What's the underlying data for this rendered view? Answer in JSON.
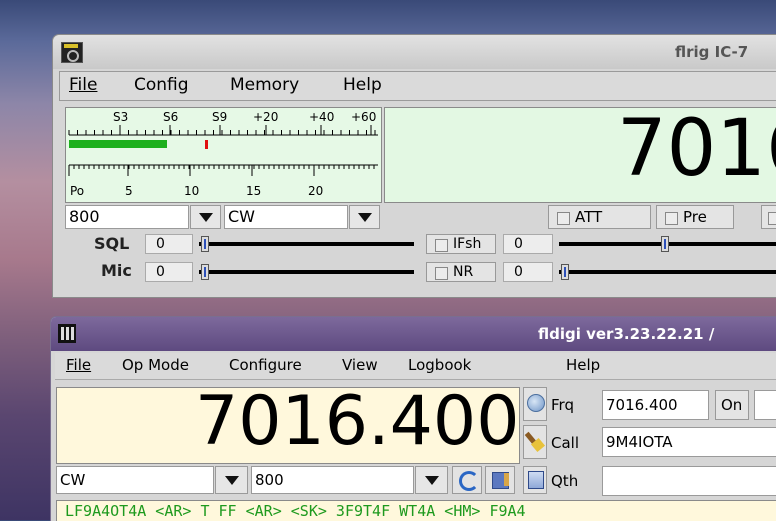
{
  "flrig": {
    "title": "flrig IC-7",
    "menu": [
      "File",
      "Config",
      "Memory",
      "Help"
    ],
    "meter_top_labels": [
      "S3",
      "S6",
      "S9",
      "+20",
      "+40",
      "+60"
    ],
    "meter_bottom_labels": [
      "Po",
      "5",
      "10",
      "15",
      "20"
    ],
    "frequency": "7016",
    "bandwidth": "800",
    "mode": "CW",
    "att_label": "ATT",
    "pre_label": "Pre",
    "sql_label": "SQL",
    "sql_value": "0",
    "mic_label": "Mic",
    "mic_value": "0",
    "ifsh_label": "IFsh",
    "ifsh_value": "0",
    "nr_label": "NR",
    "nr_value": "0",
    "signal_level": 0.31
  },
  "fldigi": {
    "title": "fldigi ver3.23.22.21 /",
    "menu": [
      "File",
      "Op Mode",
      "Configure",
      "View",
      "Logbook",
      "Help"
    ],
    "frequency": "7016.400",
    "frq_label": "Frq",
    "frq_value": "7016.400",
    "on_label": "On",
    "call_label": "Call",
    "call_value": "9M4IOTA",
    "qth_label": "Qth",
    "mode": "CW",
    "bandwidth": "800",
    "rx_text": "LF9A4OT4A  <AR> T  FF <AR> <SK>  3F9T4F  WT4A  <HM> F9A4"
  },
  "colors": {
    "freq_bg_flrig": "#e3f8e3",
    "freq_bg_fldigi": "#fff8dc",
    "meter_bar": "#1db01d",
    "rx_text": "#1e9a1e"
  }
}
